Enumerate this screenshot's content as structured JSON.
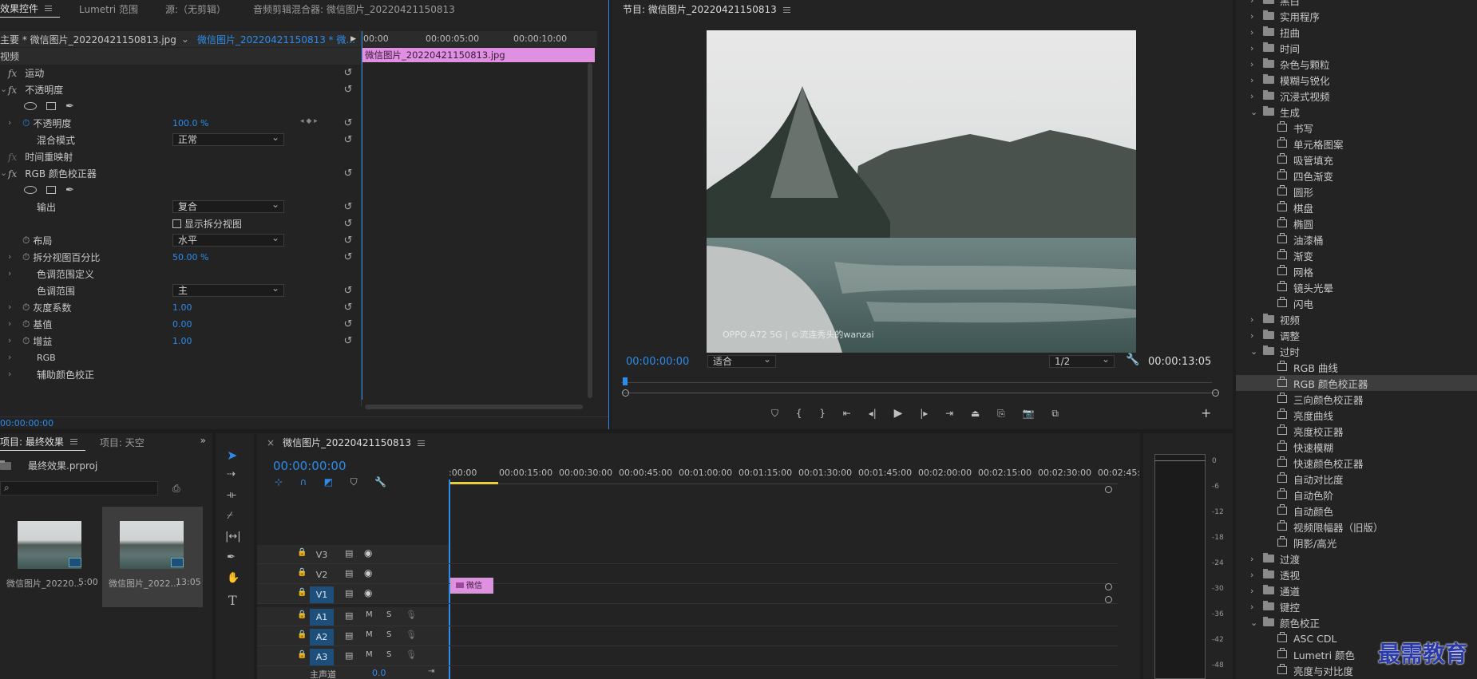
{
  "effect_controls": {
    "tabs": [
      "效果控件",
      "Lumetri 范围",
      "源:（无剪辑）",
      "音频剪辑混合器: 微信图片_20220421150813"
    ],
    "master_clip": "主要 * 微信图片_20220421150813.jpg",
    "seq_clip": "微信图片_20220421150813 * 微...",
    "timecodes": [
      "00:00",
      "00:00:05:00",
      "00:00:10:00"
    ],
    "clip_bar": "微信图片_20220421150813.jpg",
    "section": "视频",
    "rows": {
      "motion": "运动",
      "opacity": "不透明度",
      "opacity_prop": "不透明度",
      "opacity_value": "100.0 %",
      "blend_mode": "混合模式",
      "blend_value": "正常",
      "time_remap": "时间重映射",
      "rgb_corrector": "RGB 颜色校正器",
      "output": "输出",
      "output_value": "复合",
      "show_split": "显示拆分视图",
      "layout": "布局",
      "layout_value": "水平",
      "split_percent": "拆分视图百分比",
      "split_percent_value": "50.00 %",
      "tonal_range_def": "色调范围定义",
      "tonal_range": "色调范围",
      "tonal_range_value": "主",
      "gamma": "灰度系数",
      "gamma_value": "1.00",
      "pedestal": "基值",
      "pedestal_value": "0.00",
      "gain": "增益",
      "gain_value": "1.00",
      "rgb": "RGB",
      "secondary": "辅助颜色校正"
    },
    "footer_tc": "00:00:00:00"
  },
  "program": {
    "title": "节目: 微信图片_20220421150813",
    "watermark": "OPPO A72 5G | ©流连秀头的wanzai",
    "timecode": "00:00:00:00",
    "fit": "适合",
    "resolution": "1/2",
    "duration": "00:00:13:05"
  },
  "project": {
    "tabs": [
      "项目: 最终效果",
      "项目: 天空"
    ],
    "file": "最终效果.prproj",
    "items": [
      {
        "name": "微信图片_20220...",
        "dur": "5:00"
      },
      {
        "name": "微信图片_2022...",
        "dur": "13:05"
      }
    ]
  },
  "timeline": {
    "title": "微信图片_20220421150813",
    "timecode": "00:00:00:00",
    "ruler": [
      ":00:00",
      "00:00:15:00",
      "00:00:30:00",
      "00:00:45:00",
      "00:01:00:00",
      "00:01:15:00",
      "00:01:30:00",
      "00:01:45:00",
      "00:02:00:00",
      "00:02:15:00",
      "00:02:30:00",
      "00:02:45:"
    ],
    "video_tracks": [
      "V3",
      "V2",
      "V1"
    ],
    "audio_tracks": [
      "A1",
      "A2",
      "A3"
    ],
    "master": "主声道",
    "master_value": "0.0",
    "clip": "微信",
    "m": "M",
    "s": "S"
  },
  "meter": {
    "labels": [
      "0",
      "-6",
      "-12",
      "-18",
      "-24",
      "-30",
      "-36",
      "-42",
      "-48"
    ]
  },
  "effects": {
    "items": [
      {
        "type": "folder",
        "label": "黑白",
        "indent": 1
      },
      {
        "type": "folder",
        "label": "实用程序",
        "indent": 1
      },
      {
        "type": "folder",
        "label": "扭曲",
        "indent": 1
      },
      {
        "type": "folder",
        "label": "时间",
        "indent": 1
      },
      {
        "type": "folder",
        "label": "杂色与颗粒",
        "indent": 1
      },
      {
        "type": "folder",
        "label": "模糊与锐化",
        "indent": 1
      },
      {
        "type": "folder",
        "label": "沉浸式视频",
        "indent": 1
      },
      {
        "type": "folder_open",
        "label": "生成",
        "indent": 1
      },
      {
        "type": "effect",
        "label": "书写",
        "indent": 2
      },
      {
        "type": "effect",
        "label": "单元格图案",
        "indent": 2
      },
      {
        "type": "effect",
        "label": "吸管填充",
        "indent": 2
      },
      {
        "type": "effect",
        "label": "四色渐变",
        "indent": 2
      },
      {
        "type": "effect",
        "label": "圆形",
        "indent": 2
      },
      {
        "type": "effect",
        "label": "棋盘",
        "indent": 2
      },
      {
        "type": "effect",
        "label": "椭圆",
        "indent": 2
      },
      {
        "type": "effect",
        "label": "油漆桶",
        "indent": 2
      },
      {
        "type": "effect",
        "label": "渐变",
        "indent": 2
      },
      {
        "type": "effect",
        "label": "网格",
        "indent": 2
      },
      {
        "type": "effect",
        "label": "镜头光晕",
        "indent": 2
      },
      {
        "type": "effect",
        "label": "闪电",
        "indent": 2
      },
      {
        "type": "folder",
        "label": "视频",
        "indent": 1
      },
      {
        "type": "folder",
        "label": "调整",
        "indent": 1
      },
      {
        "type": "folder_open",
        "label": "过时",
        "indent": 1
      },
      {
        "type": "effect",
        "label": "RGB 曲线",
        "indent": 2
      },
      {
        "type": "effect_sel",
        "label": "RGB 颜色校正器",
        "indent": 2
      },
      {
        "type": "effect",
        "label": "三向颜色校正器",
        "indent": 2
      },
      {
        "type": "effect",
        "label": "亮度曲线",
        "indent": 2
      },
      {
        "type": "effect",
        "label": "亮度校正器",
        "indent": 2
      },
      {
        "type": "effect",
        "label": "快速模糊",
        "indent": 2
      },
      {
        "type": "effect",
        "label": "快速颜色校正器",
        "indent": 2
      },
      {
        "type": "effect",
        "label": "自动对比度",
        "indent": 2
      },
      {
        "type": "effect",
        "label": "自动色阶",
        "indent": 2
      },
      {
        "type": "effect",
        "label": "自动颜色",
        "indent": 2
      },
      {
        "type": "effect",
        "label": "视频限幅器（旧版）",
        "indent": 2
      },
      {
        "type": "effect",
        "label": "阴影/高光",
        "indent": 2
      },
      {
        "type": "folder",
        "label": "过渡",
        "indent": 1
      },
      {
        "type": "folder",
        "label": "透视",
        "indent": 1
      },
      {
        "type": "folder",
        "label": "通道",
        "indent": 1
      },
      {
        "type": "folder",
        "label": "键控",
        "indent": 1
      },
      {
        "type": "folder_open",
        "label": "颜色校正",
        "indent": 1
      },
      {
        "type": "effect",
        "label": "ASC CDL",
        "indent": 2
      },
      {
        "type": "effect",
        "label": "Lumetri 颜色",
        "indent": 2
      },
      {
        "type": "effect",
        "label": "亮度与对比度",
        "indent": 2
      }
    ]
  },
  "brand": "最需教育",
  "colors": {
    "accent": "#2d8ceb",
    "clip": "#e090e0",
    "selected": "#3d3d3d"
  }
}
